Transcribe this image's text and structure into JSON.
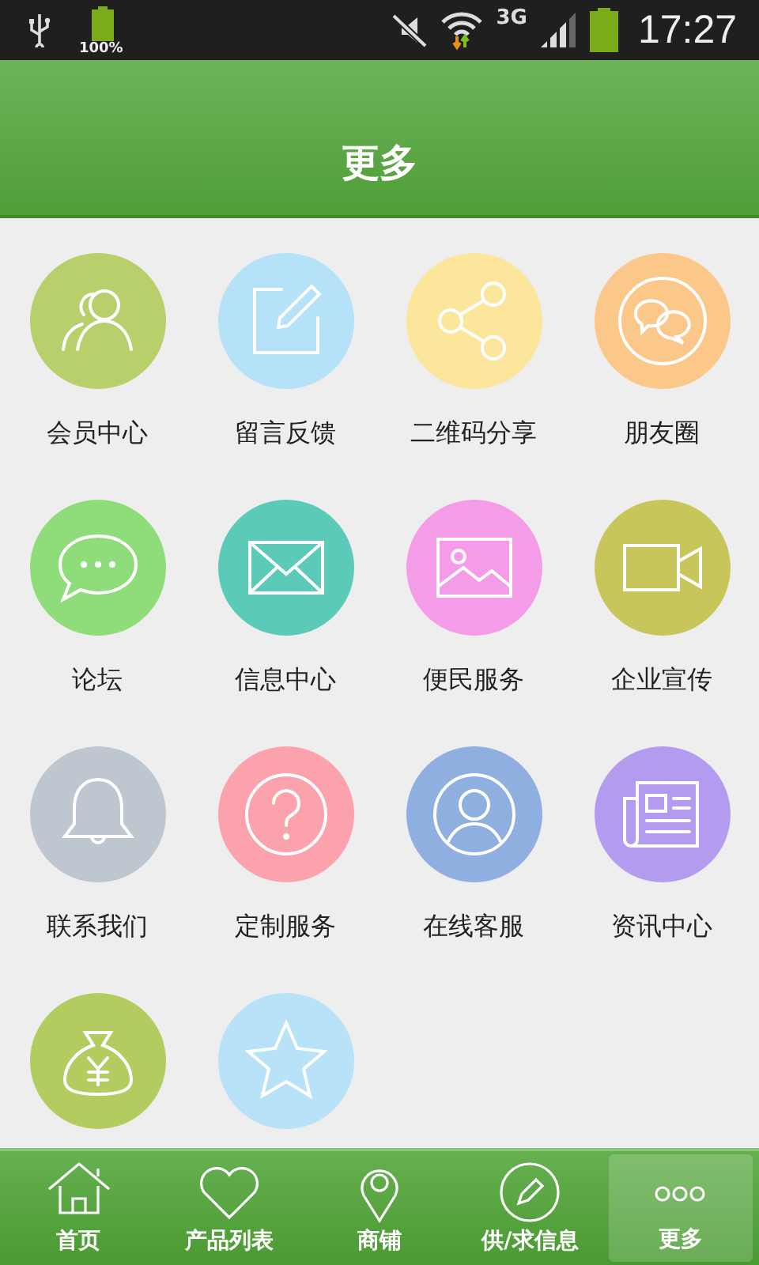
{
  "status_bar": {
    "battery_text": "100%",
    "network": "3G",
    "time": "17:27"
  },
  "header": {
    "title": "更多"
  },
  "grid": [
    {
      "label": "会员中心",
      "color": "#b7d06c",
      "kind": "people"
    },
    {
      "label": "留言反馈",
      "color": "#b5e2f8",
      "kind": "edit"
    },
    {
      "label": "二维码分享",
      "color": "#fbe69c",
      "kind": "share"
    },
    {
      "label": "朋友圈",
      "color": "#fcc88a",
      "kind": "chat"
    },
    {
      "label": "论坛",
      "color": "#8fdc7a",
      "kind": "bubble"
    },
    {
      "label": "信息中心",
      "color": "#5ccab9",
      "kind": "mail"
    },
    {
      "label": "便民服务",
      "color": "#f59ce9",
      "kind": "image"
    },
    {
      "label": "企业宣传",
      "color": "#c8c65b",
      "kind": "video"
    },
    {
      "label": "联系我们",
      "color": "#bec6d0",
      "kind": "bell"
    },
    {
      "label": "定制服务",
      "color": "#fca2ad",
      "kind": "question"
    },
    {
      "label": "在线客服",
      "color": "#8fafe0",
      "kind": "user"
    },
    {
      "label": "资讯中心",
      "color": "#b39cf0",
      "kind": "news"
    },
    {
      "color": "#b3cc60",
      "kind": "money"
    },
    {
      "color": "#b7e2f8",
      "kind": "star"
    }
  ],
  "tabs": [
    {
      "label": "首页",
      "kind": "home",
      "selected": false
    },
    {
      "label": "产品列表",
      "kind": "heart",
      "selected": false
    },
    {
      "label": "商铺",
      "kind": "pin",
      "selected": false
    },
    {
      "label": "供/求信息",
      "kind": "pencil",
      "selected": false
    },
    {
      "label": "更多",
      "kind": "dots",
      "selected": true
    }
  ]
}
